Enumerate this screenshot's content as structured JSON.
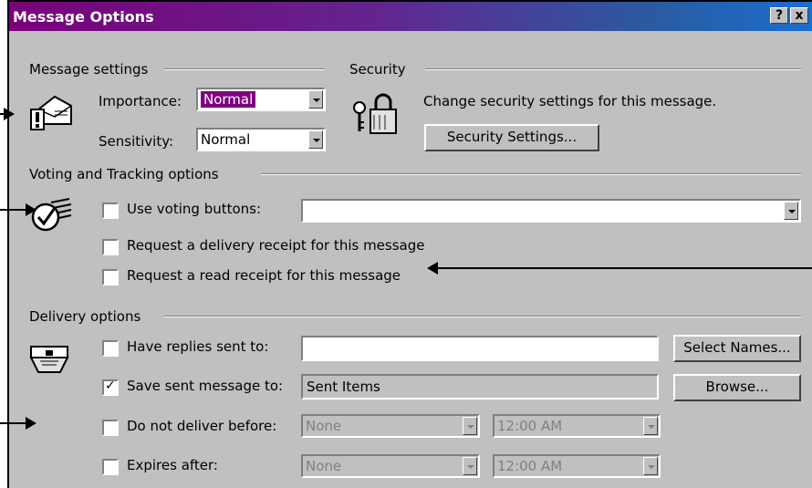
{
  "window": {
    "title": "Message Options",
    "help_button": "?",
    "close_button": "x"
  },
  "message_settings": {
    "group_label": "Message settings",
    "importance_label": "Importance:",
    "importance_value": "Normal",
    "sensitivity_label": "Sensitivity:",
    "sensitivity_value": "Normal"
  },
  "security": {
    "group_label": "Security",
    "description": "Change security settings for this message.",
    "button_label": "Security Settings..."
  },
  "voting": {
    "group_label": "Voting and Tracking options",
    "use_voting_label": "Use voting buttons:",
    "use_voting_value": "",
    "delivery_receipt_label": "Request a delivery receipt for this message",
    "read_receipt_label": "Request a read receipt for this message"
  },
  "delivery": {
    "group_label": "Delivery options",
    "replies_label": "Have replies sent to:",
    "replies_value": "",
    "select_names_button": "Select Names...",
    "save_sent_label": "Save sent message to:",
    "save_sent_value": "Sent Items",
    "browse_button": "Browse...",
    "do_not_deliver_label": "Do not deliver before:",
    "do_not_deliver_date": "None",
    "do_not_deliver_time": "12:00 AM",
    "expires_label": "Expires after:",
    "expires_date": "None",
    "expires_time": "12:00 AM"
  },
  "checkbox_states": {
    "use_voting": false,
    "delivery_receipt": false,
    "read_receipt": false,
    "have_replies": false,
    "save_sent": true,
    "do_not_deliver": false,
    "expires": false
  },
  "icons": [
    "envelope-importance-icon",
    "padlock-keys-icon",
    "voting-check-icon",
    "delivery-envelope-icon"
  ],
  "colors": {
    "title_start": "#7a007a",
    "title_end": "#1a6ed0",
    "face": "#c0c0c0",
    "selection": "#800080"
  }
}
